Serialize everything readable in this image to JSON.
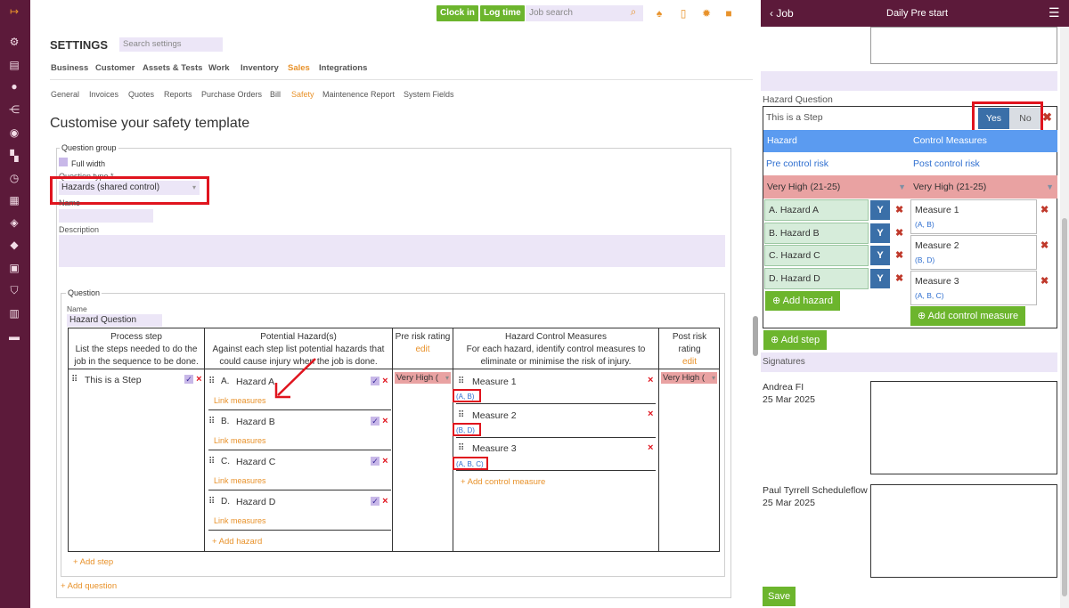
{
  "header": {
    "clock_in": "Clock in",
    "log_time": "Log time",
    "job_search_placeholder": "Job search"
  },
  "settings": {
    "title": "SETTINGS",
    "search_placeholder": "Search settings",
    "nav_primary": [
      "Business",
      "Customer",
      "Assets & Tests",
      "Work",
      "Inventory",
      "Sales",
      "Integrations"
    ],
    "nav_primary_active": "Sales",
    "nav_secondary": [
      "General",
      "Invoices",
      "Quotes",
      "Reports",
      "Purchase Orders",
      "Bill",
      "Safety",
      "Maintenence Report",
      "System Fields"
    ],
    "nav_secondary_active": "Safety",
    "page_title": "Customise your safety template"
  },
  "question_group": {
    "legend": "Question group",
    "full_width_label": "Full width",
    "question_type_label": "Question type *",
    "question_type_value": "Hazards (shared control)",
    "name_label": "Name",
    "description_label": "Description"
  },
  "question": {
    "legend": "Question",
    "name_label": "Name",
    "name_value": "Hazard Question",
    "columns": [
      {
        "title": "Process step",
        "sub": "List the steps needed to do the job in the sequence to be done."
      },
      {
        "title": "Potential Hazard(s)",
        "sub": "Against each step list potential hazards that could cause injury when the job is done."
      },
      {
        "title": "Pre risk rating",
        "sub": "edit"
      },
      {
        "title": "Hazard Control Measures",
        "sub": "For each hazard, identify control measures to eliminate or minimise the risk of injury."
      },
      {
        "title": "Post risk rating",
        "sub": "edit"
      }
    ],
    "step": "This is a Step",
    "hazards": [
      {
        "letter": "A.",
        "name": "Hazard A",
        "link": "Link measures"
      },
      {
        "letter": "B.",
        "name": "Hazard B",
        "link": "Link measures"
      },
      {
        "letter": "C.",
        "name": "Hazard C",
        "link": "Link measures"
      },
      {
        "letter": "D.",
        "name": "Hazard D",
        "link": "Link measures"
      }
    ],
    "add_hazard": "+ Add hazard",
    "pre_risk": "Very High (",
    "post_risk": "Very High (",
    "measures": [
      {
        "name": "Measure 1",
        "links": "(A, B)"
      },
      {
        "name": "Measure 2",
        "links": "(B, D)"
      },
      {
        "name": "Measure 3",
        "links": "(A, B, C)"
      }
    ],
    "add_control_measure": "+ Add control measure",
    "add_step": "+ Add step",
    "add_question": "+ Add question"
  },
  "right_panel": {
    "back": "Job",
    "title": "Daily Pre start",
    "hazard_question_label": "Hazard Question",
    "step_text": "This is a Step",
    "yes": "Yes",
    "no": "No",
    "col_hazard": "Hazard",
    "col_control": "Control Measures",
    "pre_control_risk": "Pre control risk",
    "post_control_risk": "Post control risk",
    "pre_value": "Very High (21-25)",
    "post_value": "Very High (21-25)",
    "hazards": [
      {
        "letter": "A.",
        "name": "Hazard A"
      },
      {
        "letter": "B.",
        "name": "Hazard B"
      },
      {
        "letter": "C.",
        "name": "Hazard C"
      },
      {
        "letter": "D.",
        "name": "Hazard D"
      }
    ],
    "y_label": "Y",
    "measures": [
      {
        "name": "Measure 1",
        "links": "(A, B)"
      },
      {
        "name": "Measure 2",
        "links": "(B, D)"
      },
      {
        "name": "Measure 3",
        "links": "(A, B, C)"
      }
    ],
    "add_hazard": "Add hazard",
    "add_control_measure": "Add control measure",
    "add_step": "Add step",
    "signatures_label": "Signatures",
    "signers": [
      {
        "name": "Andrea FI",
        "date": "25 Mar 2025"
      },
      {
        "name": "Paul Tyrrell Scheduleflow",
        "date": "25 Mar 2025"
      }
    ],
    "save": "Save"
  },
  "colors": {
    "sidebar": "#5c1a3a",
    "accent": "#e8922b",
    "green": "#6cb52d",
    "blue_header": "#5b9bf0",
    "risk_red": "#e9a2a2",
    "highlight": "#e0141e"
  }
}
